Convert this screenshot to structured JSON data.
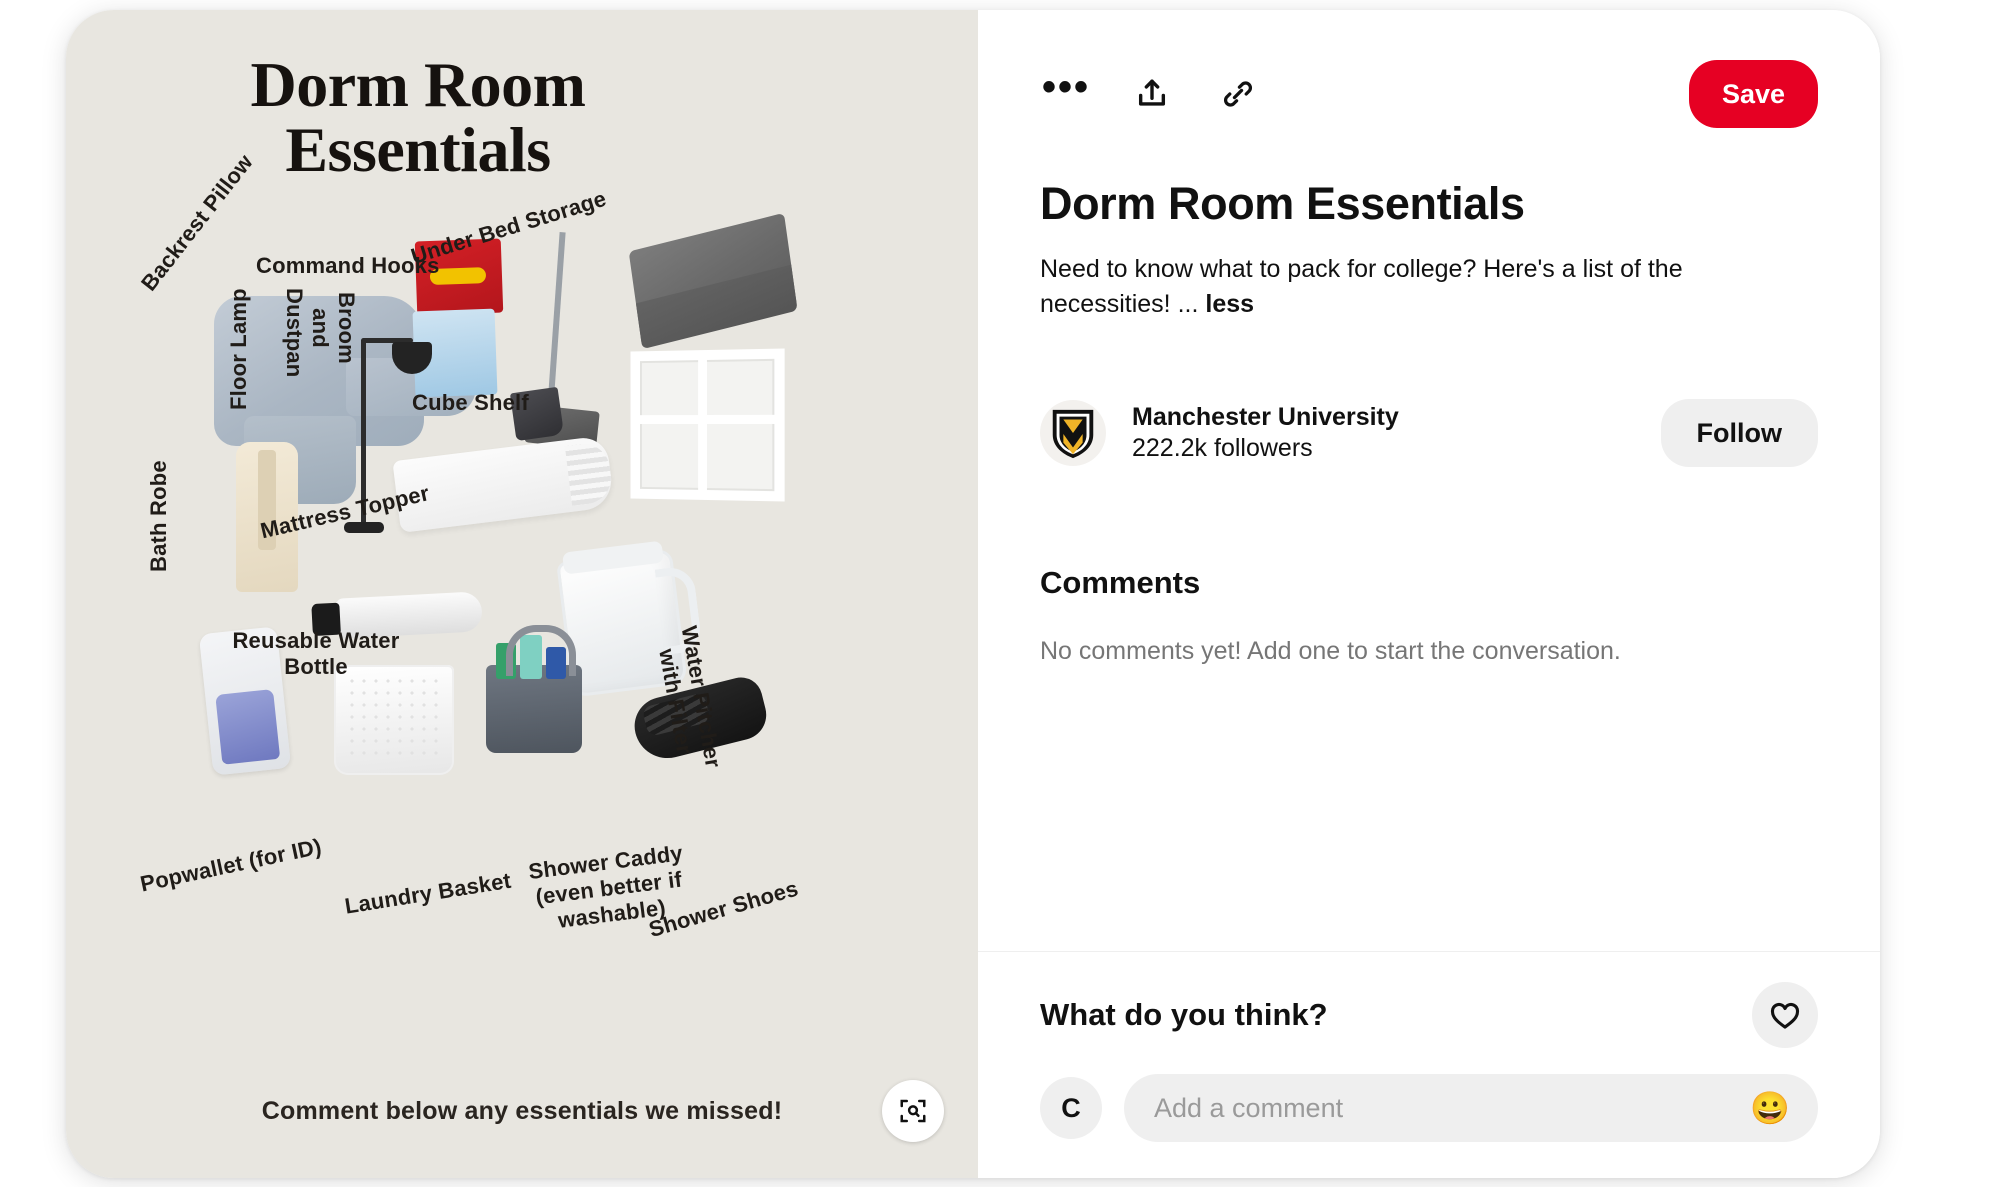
{
  "pin_image": {
    "title": "Dorm Room\nEssentials",
    "footer": "Comment below any essentials we missed!",
    "labels": {
      "backrest_pillow": "Backrest Pillow",
      "command_hooks": "Command Hooks",
      "floor_lamp": "Floor Lamp",
      "broom_and_dustpan": "Broom and\nDustpan",
      "under_bed_storage": "Under Bed Storage",
      "cube_shelf": "Cube Shelf",
      "bath_robe": "Bath Robe",
      "mattress_topper": "Mattress Topper",
      "reusable_water_bottle": "Reusable Water\nBottle",
      "water_pitcher": "Water Pitcher\nwith Filter",
      "popwallet": "Popwallet (for ID)",
      "laundry_basket": "Laundry Basket",
      "shower_caddy": "Shower Caddy\n(even better if washable)",
      "shower_shoes": "Shower Shoes"
    },
    "visual_search_icon": "visual-search-icon"
  },
  "actions": {
    "more_icon": "more-options-icon",
    "share_icon": "share-icon",
    "link_icon": "copy-link-icon",
    "save_label": "Save",
    "save_color": "#e60023"
  },
  "pin": {
    "title": "Dorm Room Essentials",
    "description": "Need to know what to pack for college? Here's a list of the necessities!",
    "ellipsis": "...",
    "less_label": "less"
  },
  "creator": {
    "avatar_icon": "manchester-university-shield-logo",
    "name": "Manchester University",
    "followers": "222.2k followers",
    "follow_label": "Follow"
  },
  "comments": {
    "heading": "Comments",
    "empty_state": "No comments yet! Add one to start the conversation."
  },
  "compose": {
    "prompt": "What do you think?",
    "heart_icon": "heart-icon",
    "avatar_initial": "C",
    "placeholder": "Add a comment",
    "emoji_icon": "grinning-face-emoji",
    "emoji_glyph": "😀"
  }
}
